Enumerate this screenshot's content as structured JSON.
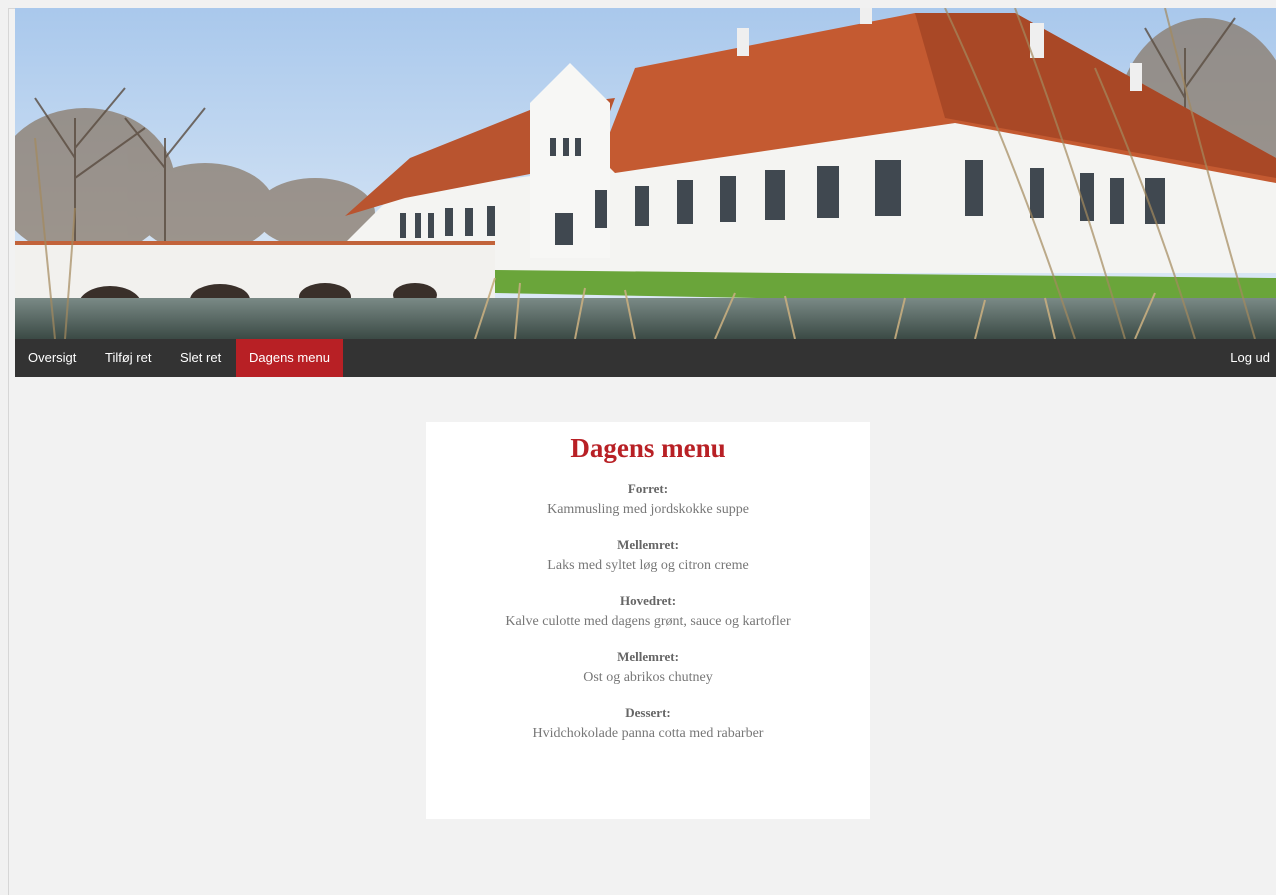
{
  "nav": {
    "items": [
      {
        "label": "Oversigt",
        "active": false
      },
      {
        "label": "Tilføj ret",
        "active": false
      },
      {
        "label": "Slet ret",
        "active": false
      },
      {
        "label": "Dagens menu",
        "active": true
      }
    ],
    "logout_label": "Log ud"
  },
  "menu": {
    "title": "Dagens menu",
    "courses": [
      {
        "label": "Forret:",
        "dish": "Kammusling med jordskokke suppe"
      },
      {
        "label": "Mellemret:",
        "dish": "Laks med syltet løg og citron creme"
      },
      {
        "label": "Hovedret:",
        "dish": "Kalve culotte med dagens grønt, sauce og kartofler"
      },
      {
        "label": "Mellemret:",
        "dish": "Ost og abrikos chutney"
      },
      {
        "label": "Dessert:",
        "dish": "Hvidchokolade panna cotta med rabarber"
      }
    ]
  },
  "colors": {
    "accent": "#b82025",
    "nav_background": "#333333",
    "page_background": "#f2f2f2"
  }
}
